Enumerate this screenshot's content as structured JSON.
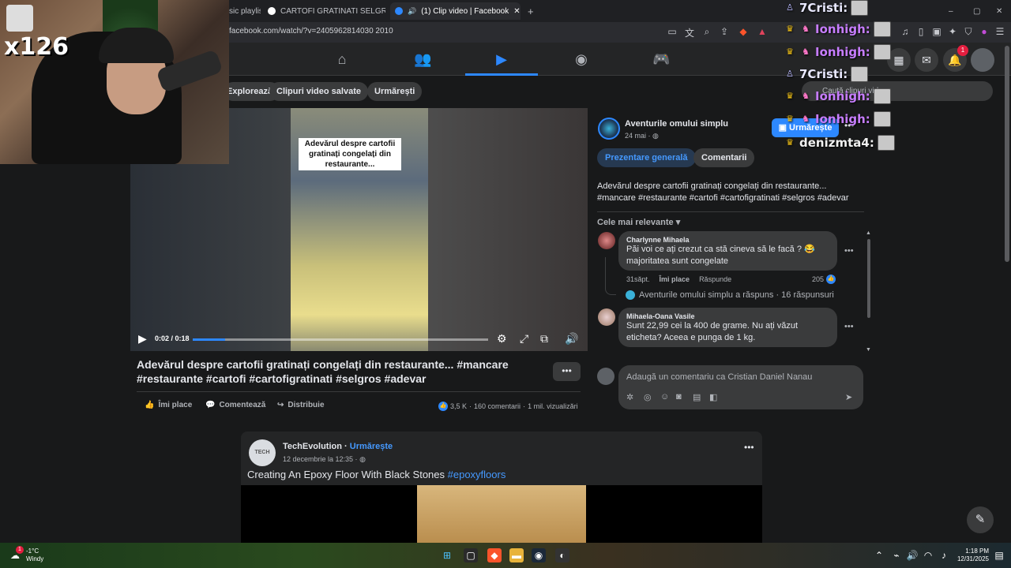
{
  "browser": {
    "tabs": [
      {
        "label": "sic playlis"
      },
      {
        "label": "CARTOFI GRATINATI SELGROS - Căut"
      },
      {
        "label": "(1) Clip video | Facebook"
      }
    ],
    "new_tab": "+",
    "url": "facebook.com/watch/?v=2405962814030 2010",
    "window_controls": [
      "–",
      "▢",
      "✕"
    ]
  },
  "fb": {
    "notification_count": "1",
    "subtabs": [
      "Explorează",
      "Clipuri video salvate",
      "Urmărești"
    ],
    "search_placeholder": "Caută clipuri video"
  },
  "video": {
    "caption": "Adevărul despre cartofii gratinați congelați din restaurante...",
    "timecode": "0:02 / 0:18",
    "progress": 0.11,
    "title": "Adevărul despre cartofii gratinați congelați din restaurante... #mancare #restaurante #cartofi #cartofigratinati #selgros #adevar",
    "actions": {
      "like": "Îmi place",
      "comment": "Comentează",
      "share": "Distribuie"
    },
    "stats": {
      "likes": "3,5 K",
      "comments": "160 comentarii",
      "views": "1 mil. vizualizări",
      "sep": "·"
    }
  },
  "page": {
    "name": "Aventurile omului simplu",
    "date": "24 mai · ",
    "follow": "Urmărește",
    "tabs": [
      "Prezentare generală",
      "Comentarii"
    ],
    "description": "Adevărul despre cartofii gratinați congelați din restaurante... #mancare #restaurante #cartofi #cartofigratinati #selgros #adevar",
    "sort": "Cele mai relevante"
  },
  "comments": [
    {
      "name": "Charlynne Mihaela",
      "text": "Păi voi ce ați crezut ca stă cineva să le facă ? 😂 majoritatea sunt congelate",
      "age": "31săpt.",
      "like": "Îmi place",
      "reply": "Răspunde",
      "reactions": "205",
      "thread": "Aventurile omului simplu a răspuns · 16 răspunsuri"
    },
    {
      "name": "Mihaela-Oana Vasile",
      "text": "Sunt 22,99 cei la 400 de grame. Nu ați văzut eticheta? Aceea e punga de 1 kg."
    }
  ],
  "composer": {
    "placeholder": "Adaugă un comentariu ca Cristian Daniel Nanau"
  },
  "post": {
    "author": "TechEvolution",
    "follow": "Urmărește",
    "date": "12 decembrie la 12:35 · ",
    "text": "Creating An Epoxy Floor With Black Stones",
    "hashtag": "#epoxyfloors",
    "avatar_text": "TECH"
  },
  "taskbar": {
    "weather_temp": "-1°C",
    "weather_desc": "Windy",
    "weather_badge": "1",
    "time": "1:18 PM",
    "date": "12/31/2025"
  },
  "stream": {
    "combo": "x126",
    "chat": [
      {
        "user": "7Cristi:",
        "color": "#e8e8ff"
      },
      {
        "user": "Ionhigh:",
        "color": "#c77dff"
      },
      {
        "user": "Ionhigh:",
        "color": "#c77dff"
      },
      {
        "user": "7Cristi:",
        "color": "#e8e8ff"
      },
      {
        "user": "Ionhigh:",
        "color": "#c77dff"
      },
      {
        "user": "Ionhigh:",
        "color": "#c77dff"
      },
      {
        "user": "denizmta4:",
        "color": "#f0f0f0"
      }
    ]
  },
  "colors": {
    "accent": "#2d88ff",
    "bg": "#18191a",
    "surface": "#242526",
    "chip": "#3a3b3c"
  }
}
